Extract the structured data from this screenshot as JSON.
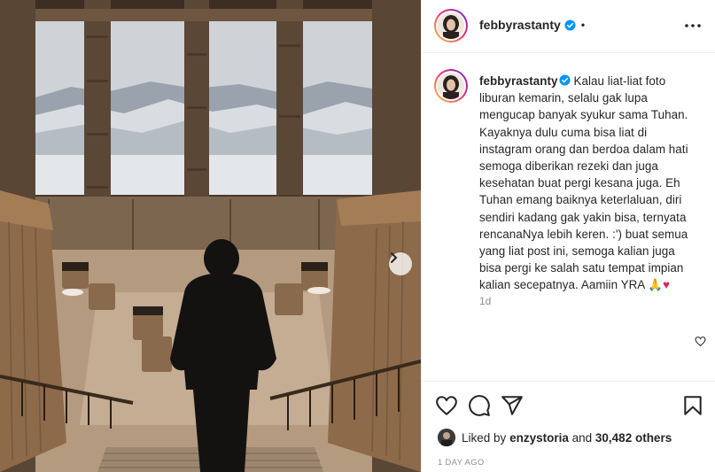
{
  "post": {
    "username": "febbyrastanty",
    "header_separator": "•",
    "caption_lines": [
      "Kalau liat-liat foto",
      "liburan kemarin, selalu gak lupa",
      "mengucap banyak syukur sama Tuhan.",
      "Kayaknya dulu cuma bisa liat di",
      "instagram orang dan berdoa dalam hati",
      "semoga diberikan rezeki dan juga",
      "kesehatan buat pergi kesana juga. Eh",
      "Tuhan emang baiknya keterlaluan, diri",
      "sendiri kadang gak yakin bisa, ternyata",
      "rencanaNya lebih keren. :') buat semua",
      "yang liat post ini, semoga kalian juga",
      "bisa pergi ke salah satu tempat impian",
      "kalian secepatnya. Aamiin YRA"
    ],
    "caption_emoji_pray": "🙏",
    "caption_emoji_heart": "♥",
    "caption_age": "1d",
    "likes_prefix": "Liked by",
    "likes_user": "enzystoria",
    "likes_and": "and",
    "likes_count": "30,482 others",
    "date": "1 DAY AGO"
  },
  "icons": {
    "verified": "verified-badge-icon",
    "more": "more-options-icon",
    "like": "heart-icon",
    "comment": "comment-icon",
    "share": "share-icon",
    "save": "bookmark-icon",
    "next": "chevron-right-icon"
  },
  "colors": {
    "verified_blue": "#0095f6",
    "text_primary": "#262626",
    "text_secondary": "#8e8e8e",
    "divider": "#efefef"
  }
}
